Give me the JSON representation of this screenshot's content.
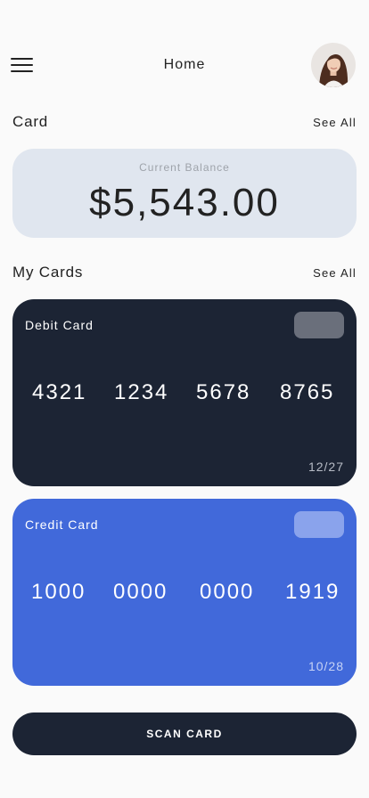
{
  "header": {
    "title": "Home",
    "menu_icon": "hamburger-menu-icon",
    "avatar_icon": "user-avatar"
  },
  "card_section": {
    "title": "Card",
    "see_all": "See All",
    "balance_label": "Current Balance",
    "balance_amount": "$5,543.00"
  },
  "my_cards_section": {
    "title": "My Cards",
    "see_all": "See All"
  },
  "cards": [
    {
      "type": "Debit Card",
      "number_groups": [
        "4321",
        "1234",
        "5678",
        "8765"
      ],
      "expiry": "12/27",
      "color": "#1c2434"
    },
    {
      "type": "Credit Card",
      "number_groups": [
        "1000",
        "0000",
        "0000",
        "1919"
      ],
      "expiry": "10/28",
      "color": "#4169da"
    }
  ],
  "scan_button": {
    "label": "SCAN CARD",
    "color": "#1c2434"
  }
}
